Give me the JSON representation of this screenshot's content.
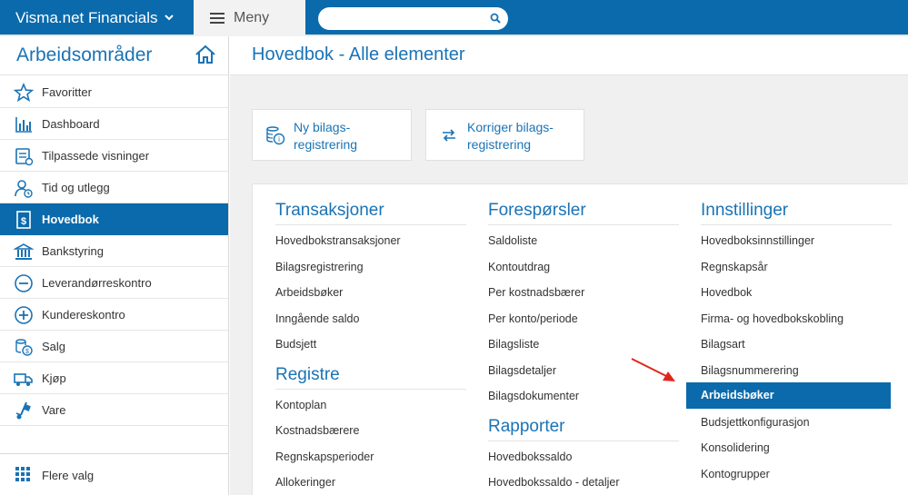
{
  "topbar": {
    "brand": "Visma.net Financials",
    "menu_label": "Meny",
    "search_placeholder": ""
  },
  "sidebar": {
    "title": "Arbeidsområder",
    "items": [
      {
        "label": "Favoritter",
        "icon": "star-icon"
      },
      {
        "label": "Dashboard",
        "icon": "bar-chart-icon"
      },
      {
        "label": "Tilpassede visninger",
        "icon": "custom-view-icon"
      },
      {
        "label": "Tid og utlegg",
        "icon": "time-expense-icon"
      },
      {
        "label": "Hovedbok",
        "icon": "ledger-icon",
        "active": true
      },
      {
        "label": "Bankstyring",
        "icon": "bank-icon"
      },
      {
        "label": "Leverandørreskontro",
        "icon": "minus-circle-icon"
      },
      {
        "label": "Kundereskontro",
        "icon": "plus-circle-icon"
      },
      {
        "label": "Salg",
        "icon": "sales-icon"
      },
      {
        "label": "Kjøp",
        "icon": "truck-icon"
      },
      {
        "label": "Vare",
        "icon": "hand-truck-icon"
      }
    ],
    "more_label": "Flere valg"
  },
  "main": {
    "title": "Hovedbok - Alle elementer",
    "tiles": [
      {
        "line1": "Ny bilags-",
        "line2": "registrering",
        "icon": "coins-icon"
      },
      {
        "line1": "Korriger bilags-",
        "line2": "registrering",
        "icon": "swap-arrows-icon"
      }
    ],
    "sections": {
      "transaksjoner": {
        "title": "Transaksjoner",
        "links": [
          "Hovedbokstransaksjoner",
          "Bilagsregistrering",
          "Arbeidsbøker",
          "Inngående saldo",
          "Budsjett"
        ]
      },
      "registre": {
        "title": "Registre",
        "links": [
          "Kontoplan",
          "Kostnadsbærere",
          "Regnskapsperioder",
          "Allokeringer"
        ]
      },
      "foresporsler": {
        "title": "Forespørsler",
        "links": [
          "Saldoliste",
          "Kontoutdrag",
          "Per kostnadsbærer",
          "Per konto/periode",
          "Bilagsliste",
          "Bilagsdetaljer",
          "Bilagsdokumenter"
        ]
      },
      "rapporter": {
        "title": "Rapporter",
        "links": [
          "Hovedbokssaldo",
          "Hovedbokssaldo - detaljer"
        ]
      },
      "innstillinger": {
        "title": "Innstillinger",
        "links": [
          "Hovedboksinnstillinger",
          "Regnskapsår",
          "Hovedbok",
          "Firma- og hovedbokskobling",
          "Bilagsart",
          "Bilagsnummerering",
          "Arbeidsbøker",
          "Budsjettkonfigurasjon",
          "Konsolidering",
          "Kontogrupper"
        ],
        "highlighted_index": 6
      }
    }
  },
  "colors": {
    "brand_blue": "#0a6aac",
    "link_blue": "#1a73b5",
    "annotation_red": "#e0261b"
  }
}
